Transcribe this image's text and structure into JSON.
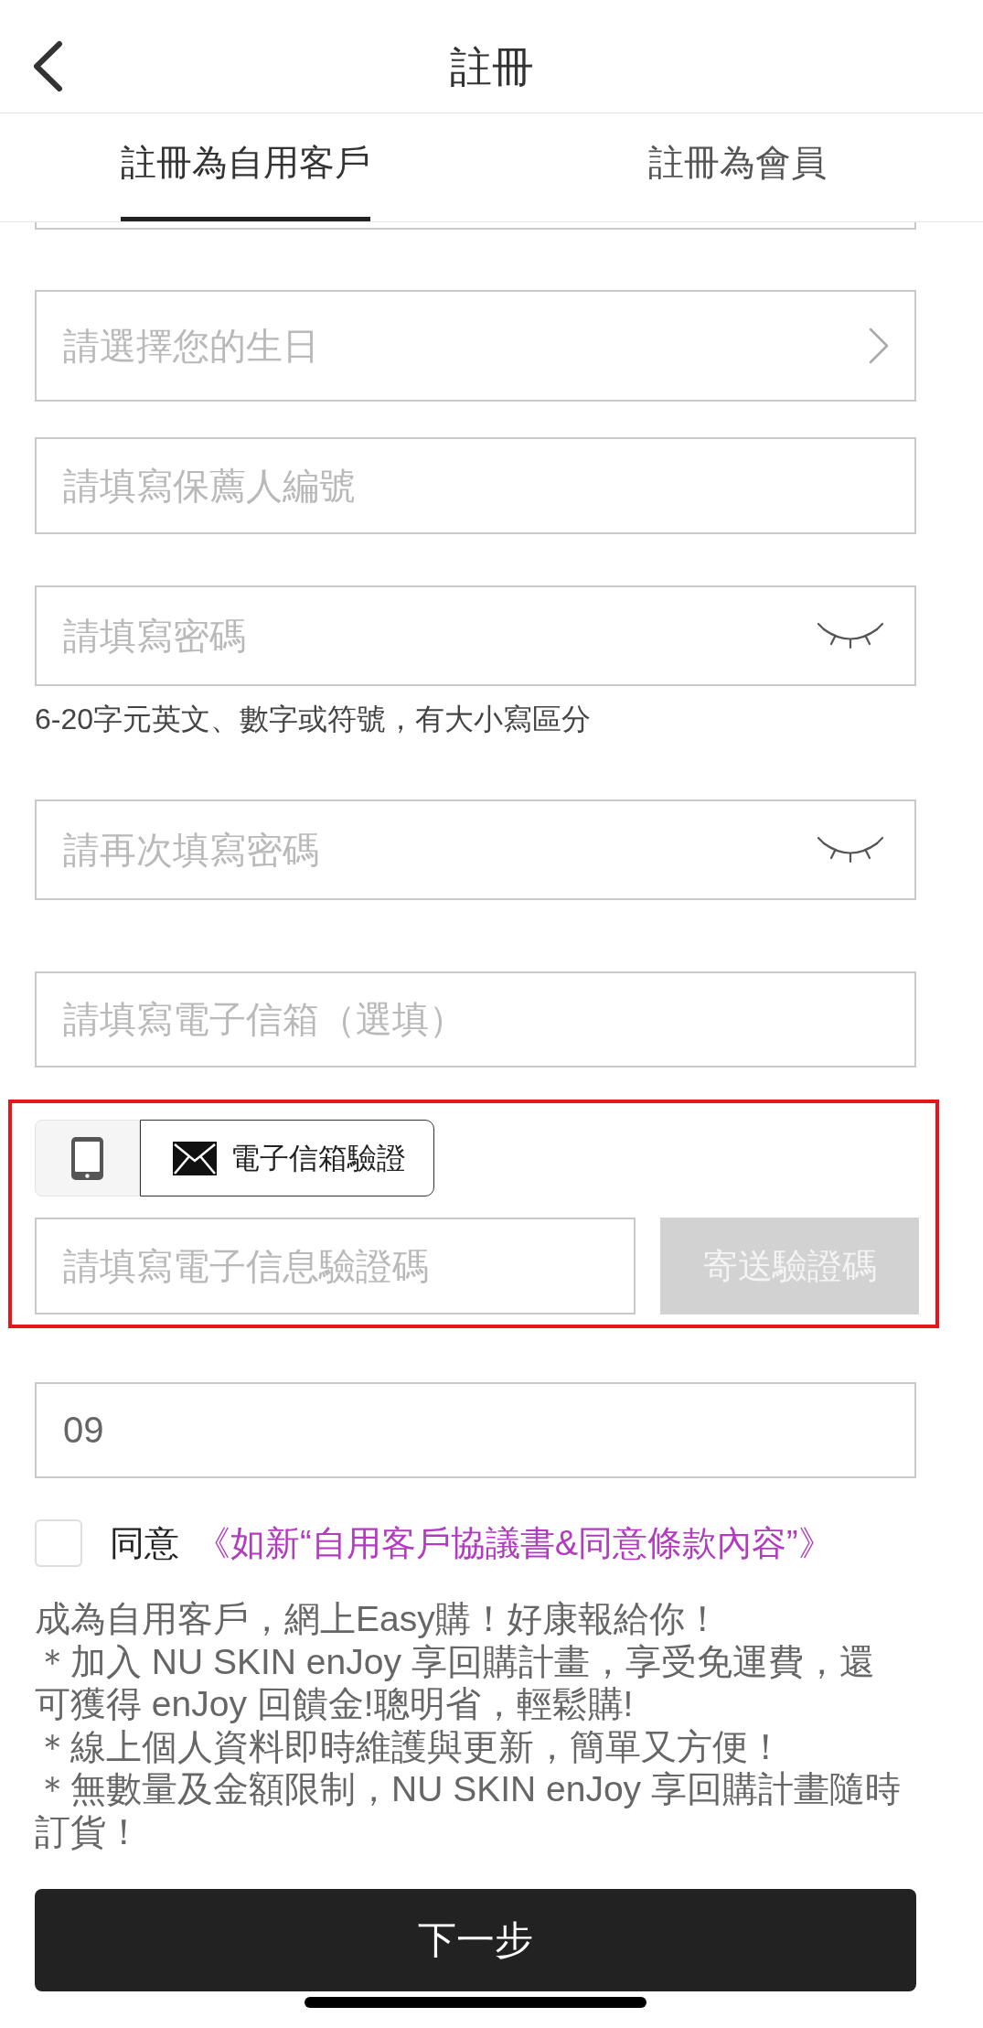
{
  "header": {
    "title": "註冊"
  },
  "tabs": [
    {
      "label": "註冊為自用客戶",
      "selected": true
    },
    {
      "label": "註冊為會員",
      "selected": false
    }
  ],
  "fields": [
    {
      "kind": "clipped"
    },
    {
      "kind": "select",
      "placeholder": "請選擇您的生日"
    },
    {
      "kind": "text",
      "placeholder": "請填寫保薦人編號"
    },
    {
      "kind": "password",
      "placeholder": "請填寫密碼",
      "hint": "6-20字元英文、數字或符號，有大小寫區分"
    },
    {
      "kind": "password",
      "placeholder": "請再次填寫密碼"
    },
    {
      "kind": "text",
      "placeholder": "請填寫電子信箱（選填）"
    }
  ],
  "verification": {
    "methods": [
      {
        "kind": "phone",
        "selected": false
      },
      {
        "kind": "email",
        "label": "電子信箱驗證",
        "selected": true
      }
    ],
    "code_field": {
      "placeholder": "請填寫電子信息驗證碼"
    },
    "send_button": {
      "label": "寄送驗證碼",
      "disabled": true
    }
  },
  "phone_field": {
    "value": "09"
  },
  "agreement": {
    "checked": false,
    "label": "同意",
    "link": "《如新“自用客戶協議書&同意條款內容”》"
  },
  "promo_lines": [
    "成為自用客戶，網上Easy購！好康報給你！",
    "＊加入 NU SKIN enJoy 享回購計畫，享受免運費，還可獲得 enJoy 回饋金!聰明省，輕鬆購!",
    "＊線上個人資料即時維護與更新，簡單又方便！",
    "＊無數量及金額限制，NU SKIN enJoy 享回購計畫隨時訂貨！"
  ],
  "next_button": {
    "label": "下一步"
  }
}
